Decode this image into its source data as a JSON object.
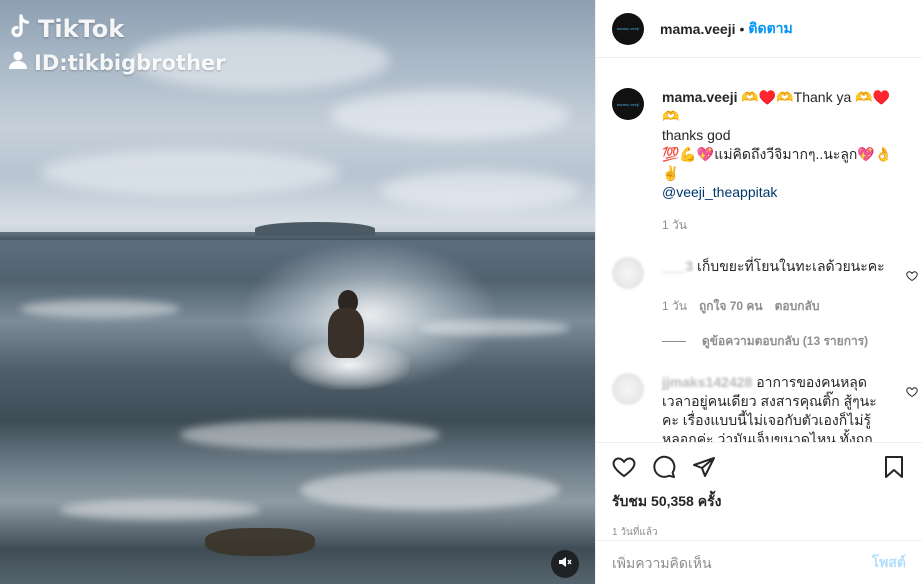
{
  "media": {
    "watermark_brand": "TikTok",
    "watermark_id": "ID:tikbigbrother",
    "mute_icon": "speaker-muted-icon"
  },
  "header": {
    "username": "mama.veeji",
    "dot": "•",
    "follow_label": "ติดตาม",
    "avatar_text": "mama.veeji"
  },
  "caption": {
    "username": "mama.veeji",
    "line1": "🫶♥️🫶Thank ya 🫶♥️🫶",
    "line2": "thanks god",
    "line3": "💯💪💖แม่คิดถึงวีจิมากๆ..นะลูก💖👌✌️",
    "mention": "@veeji_theappitak",
    "time": "1 วัน"
  },
  "comments": [
    {
      "username": "___3",
      "text": " เก็บขยะที่โยนในทะเลด้วยนะคะ",
      "time": "1 วัน",
      "likes": "ถูกใจ 70 คน",
      "reply": "ตอบกลับ",
      "view_replies": "ดูข้อความตอบกลับ (13 รายการ)"
    },
    {
      "username": "jjmaks142428",
      "text": " อาการของคนหลุดเวลาอยู่คนเดียว สงสารคุณติ๊ก สู้ๆนะคะ เรื่องแบบนี้ไม่เจอกับตัวเองก็ไม่รู้หลอกค่ะ ว่ามันเจ็บขนาดไหน ทั้งถูกคนรักเลิก ทั้งถูกห้ามเรื่องลูก ทั้งถูกทวงหนี้ ทั้งโดนประจาน ทั้งเสียเงิน ถ้าเป็นเรา จะทำแบบคุณติ๊กได้มั้ยเนี่ย นับถือจริงๆ ผู้หญิงคนนี้"
    }
  ],
  "actions": {
    "like_icon": "heart-icon",
    "comment_icon": "comment-icon",
    "share_icon": "share-icon",
    "save_icon": "bookmark-icon",
    "likes": "รับชม 50,358 ครั้ง",
    "posted": "1 วันที่แล้ว"
  },
  "add_comment": {
    "placeholder": "เพิ่มความคิดเห็น",
    "post_label": "โพสต์"
  },
  "colors": {
    "accent": "#0095f6",
    "post_disabled": "#b2dffc",
    "muted_text": "#8e8e8e"
  }
}
